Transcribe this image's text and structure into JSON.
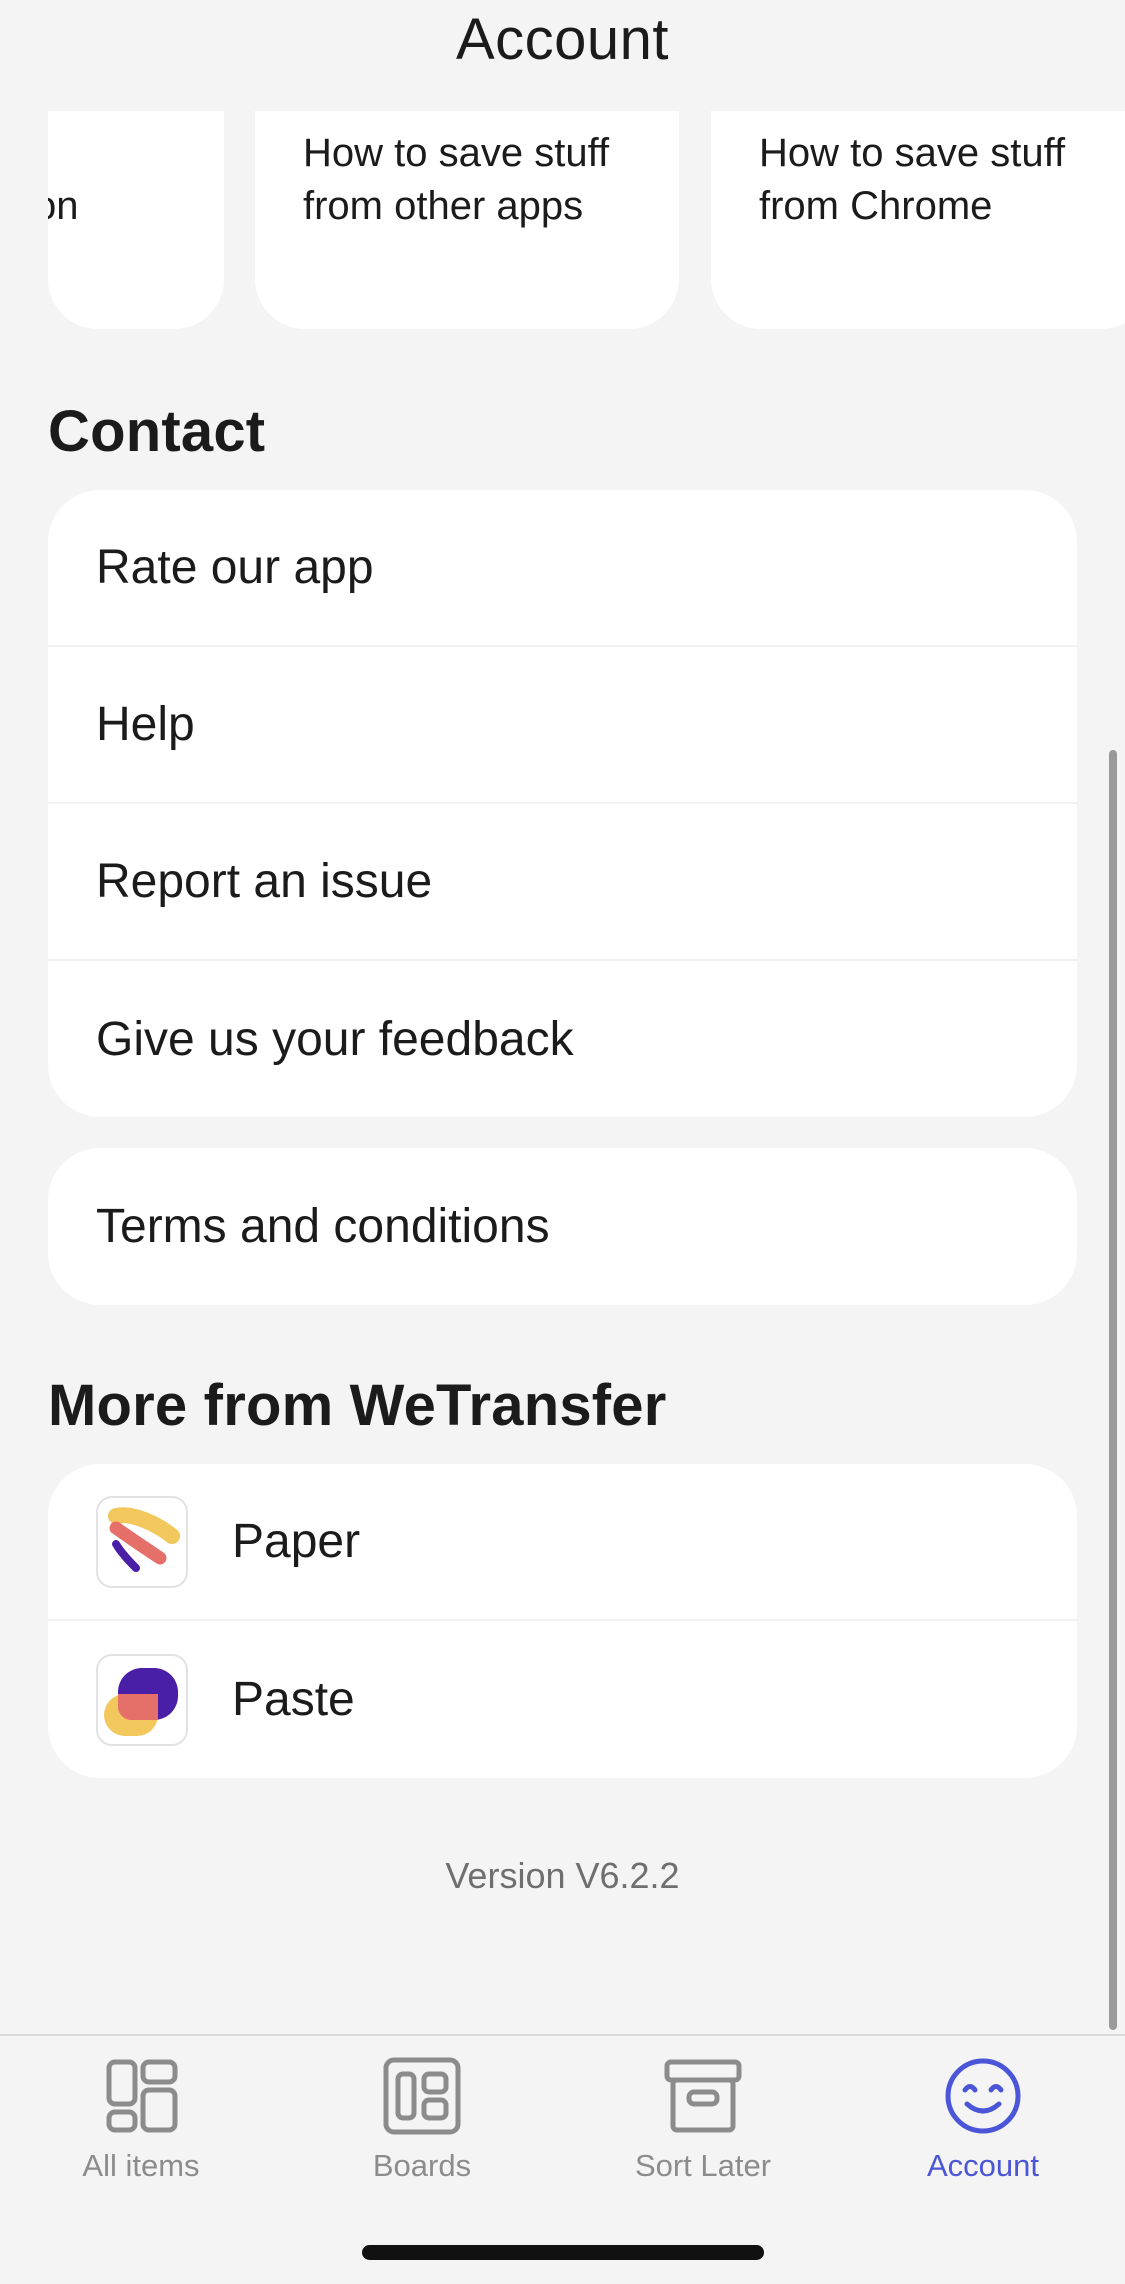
{
  "header": {
    "title": "Account"
  },
  "tutorials": {
    "cards": [
      {
        "label": "on"
      },
      {
        "label": "How to save stuff from other apps"
      },
      {
        "label": "How to save stuff from Chrome"
      }
    ]
  },
  "contact": {
    "heading": "Contact",
    "items": [
      {
        "label": "Rate our app"
      },
      {
        "label": "Help"
      },
      {
        "label": "Report an issue"
      },
      {
        "label": "Give us your feedback"
      }
    ]
  },
  "legal": {
    "terms_label": "Terms and conditions"
  },
  "more": {
    "heading": "More from WeTransfer",
    "apps": [
      {
        "label": "Paper",
        "icon": "paper-app-icon"
      },
      {
        "label": "Paste",
        "icon": "paste-app-icon"
      }
    ]
  },
  "version": "Version V6.2.2",
  "tabbar": {
    "tabs": [
      {
        "label": "All items",
        "icon": "all-items-icon",
        "active": false
      },
      {
        "label": "Boards",
        "icon": "boards-icon",
        "active": false
      },
      {
        "label": "Sort Later",
        "icon": "archive-box-icon",
        "active": false
      },
      {
        "label": "Account",
        "icon": "smiley-face-icon",
        "active": true
      }
    ]
  },
  "colors": {
    "background": "#f4f4f4",
    "card": "#ffffff",
    "accent": "#4a55d8",
    "inactive_tab": "#8c8c8c",
    "paper_yellow": "#f2c75c",
    "paper_red": "#e5706a",
    "paste_purple": "#4a1fa8"
  }
}
